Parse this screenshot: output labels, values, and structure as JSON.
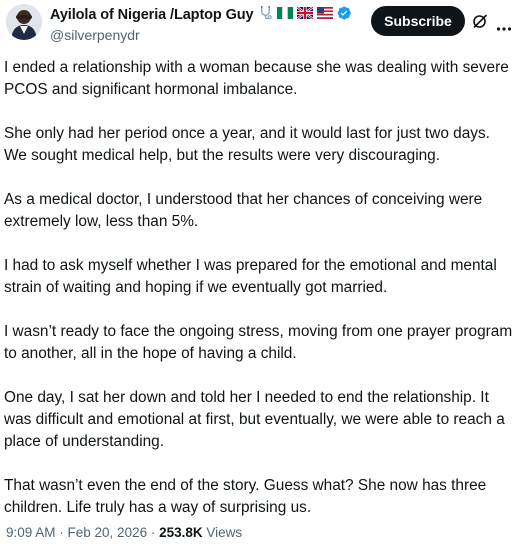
{
  "header": {
    "display_name": "Ayilola of Nigeria /Laptop Guy",
    "handle": "@silverpenydr",
    "subscribe_label": "Subscribe",
    "icons": [
      "stethoscope-icon",
      "nigeria-flag-icon",
      "uk-flag-icon",
      "us-flag-icon",
      "verified-badge-icon",
      "grok-icon",
      "more-icon"
    ]
  },
  "post": {
    "paragraphs": [
      "I ended a relationship with a woman because she was dealing with severe PCOS and significant hormonal imbalance.",
      "She only had her period once a year, and it would last for just two days. We sought medical help, but the results were very discouraging.",
      "As a medical doctor, I understood that her chances of conceiving were extremely low, less than 5%.",
      "I had to ask myself whether I was prepared for the emotional and mental strain of waiting and hoping if we eventually got married.",
      "I wasn’t ready to face the ongoing stress, moving from one prayer program to another, all in the hope of having a child.",
      "One day, I sat her down and told her I needed to end the relationship. It was difficult and emotional at first, but eventually, we were able to reach a place of understanding.",
      "That wasn’t even the end of the story. Guess what? She now has three children. Life truly has a way of surprising us."
    ]
  },
  "meta": {
    "time": "9:09 AM",
    "separator": " · ",
    "date": "Feb 20, 2026",
    "views_count": "253.8K",
    "views_label": " Views"
  },
  "colors": {
    "text": "#0f1419",
    "secondary": "#536471",
    "verified": "#1d9bf0",
    "button": "#0f1419"
  }
}
